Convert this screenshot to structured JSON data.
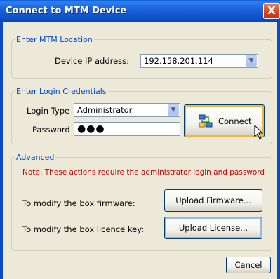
{
  "window": {
    "title": "Connect to MTM Device",
    "close_glyph": "X"
  },
  "location": {
    "legend": "Enter MTM Location",
    "ip_label": "Device IP address:",
    "ip_value": "192.158.201.114"
  },
  "credentials": {
    "legend": "Enter Login Credentials",
    "login_type_label": "Login Type",
    "login_type_value": "Administrator",
    "password_label": "Password",
    "password_mask": "●●●",
    "connect_label": "Connect"
  },
  "advanced": {
    "legend": "Advanced",
    "note": "Note: These actions require the administrator login and password",
    "firmware_label": "To modify the box firmware:",
    "firmware_button": "Upload Firmware...",
    "license_label": "To modify the box licence key:",
    "license_button": "Upload License..."
  },
  "footer": {
    "cancel_label": "Cancel"
  },
  "colors": {
    "title_bar": "#0f50c8",
    "legend_text": "#0046d5",
    "note_text": "#cc0000",
    "close_button": "#d8431c"
  }
}
